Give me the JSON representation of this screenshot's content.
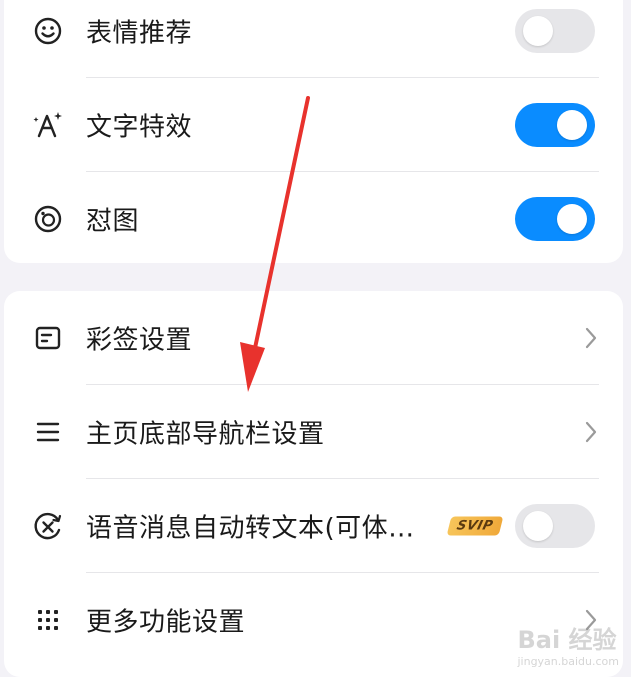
{
  "settings_group_1": [
    {
      "label": "表情推荐",
      "icon": "smile-icon",
      "control": "toggle",
      "state": "off"
    },
    {
      "label": "文字特效",
      "icon": "text-effect-icon",
      "control": "toggle",
      "state": "on"
    },
    {
      "label": "怼图",
      "icon": "sticker-face-icon",
      "control": "toggle",
      "state": "on"
    }
  ],
  "settings_group_2": [
    {
      "label": "彩签设置",
      "icon": "label-card-icon",
      "control": "chevron"
    },
    {
      "label": "主页底部导航栏设置",
      "icon": "menu-lines-icon",
      "control": "chevron"
    },
    {
      "label": "语音消息自动转文本(可体…",
      "icon": "voice-to-text-icon",
      "control": "toggle",
      "state": "off",
      "badge": "SVIP"
    },
    {
      "label": "更多功能设置",
      "icon": "grid-dots-icon",
      "control": "chevron"
    }
  ],
  "colors": {
    "toggle_on": "#0a8cff",
    "toggle_off": "#e6e6e9",
    "annotation_arrow": "#e8322d"
  },
  "watermark": {
    "brand": "Bai 经验",
    "url": "jingyan.baidu.com"
  }
}
